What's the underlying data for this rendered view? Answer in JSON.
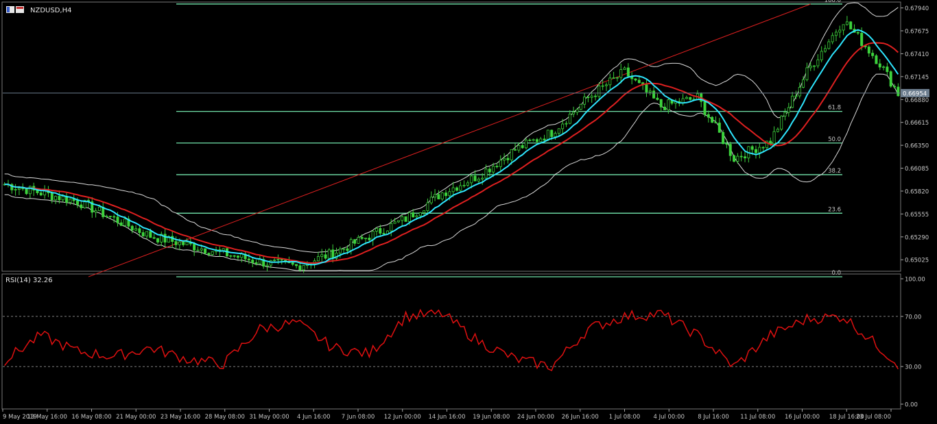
{
  "symbol_title": "NZDUSD,H4",
  "indicator_label": "RSI(14) 32.26",
  "current_price_label": "0.66954",
  "colors": {
    "background": "#000000",
    "candle": "#3cd23c",
    "fib": "#7fffbf",
    "trendline": "#e02020",
    "ma_fast": "#2ee6ff",
    "ma_slow": "#e02020",
    "bands": "#dcdcdc",
    "rsi": "#e01010",
    "axis_text": "#c8c8c8",
    "price_line": "#6d7e8f"
  },
  "chart_data": [
    {
      "type": "line",
      "name": "price",
      "title": "NZDUSD,H4",
      "price_ticks": [
        "0.67940",
        "0.67675",
        "0.67410",
        "0.67145",
        "0.66880",
        "0.66615",
        "0.66350",
        "0.66085",
        "0.65820",
        "0.65555",
        "0.65290",
        "0.65025"
      ],
      "ylim": [
        0.649,
        0.68
      ],
      "current_price": 0.66954,
      "fibonacci_levels": [
        {
          "label": "100.0",
          "price": 0.67985
        },
        {
          "label": "61.8",
          "price": 0.66742
        },
        {
          "label": "50.0",
          "price": 0.66376
        },
        {
          "label": "38.2",
          "price": 0.6601
        },
        {
          "label": "23.6",
          "price": 0.65564
        },
        {
          "label": "0.0",
          "price": 0.64828
        }
      ],
      "trendline": {
        "from": [
          23,
          0.64828
        ],
        "to": [
          221,
          0.67985
        ]
      },
      "x": [
        0,
        10,
        20,
        30,
        40,
        50,
        60,
        70,
        80,
        90,
        100,
        110,
        120,
        130,
        140,
        150,
        160,
        170,
        180,
        190,
        200,
        210,
        220,
        230,
        240,
        245
      ],
      "close": [
        0.659,
        0.658,
        0.657,
        0.655,
        0.653,
        0.652,
        0.651,
        0.65,
        0.6495,
        0.651,
        0.653,
        0.655,
        0.658,
        0.66,
        0.663,
        0.665,
        0.669,
        0.672,
        0.668,
        0.669,
        0.662,
        0.664,
        0.672,
        0.678,
        0.673,
        0.6695
      ]
    },
    {
      "type": "line",
      "name": "rsi",
      "title": "RSI(14) 32.26",
      "rsi_ticks": [
        "100.00",
        "70.00",
        "30.00",
        "0.00"
      ],
      "ylim": [
        0,
        100
      ],
      "levels": [
        70,
        30
      ],
      "x": [
        0,
        10,
        20,
        30,
        40,
        50,
        60,
        70,
        80,
        90,
        100,
        110,
        120,
        130,
        140,
        150,
        160,
        170,
        180,
        190,
        200,
        210,
        220,
        230,
        240,
        245
      ],
      "values": [
        35,
        55,
        42,
        38,
        45,
        36,
        32,
        60,
        65,
        45,
        40,
        70,
        72,
        50,
        36,
        30,
        60,
        70,
        72,
        55,
        30,
        55,
        68,
        70,
        45,
        32
      ]
    }
  ],
  "time_labels": [
    "9 May 2019",
    "13 May 16:00",
    "16 May 08:00",
    "21 May 00:00",
    "23 May 16:00",
    "28 May 08:00",
    "31 May 00:00",
    "4 Jun 16:00",
    "7 Jun 08:00",
    "12 Jun 00:00",
    "14 Jun 16:00",
    "19 Jun 08:00",
    "24 Jun 00:00",
    "26 Jun 16:00",
    "1 Jul 08:00",
    "4 Jul 00:00",
    "8 Jul 16:00",
    "11 Jul 08:00",
    "16 Jul 00:00",
    "18 Jul 16:00",
    "23 Jul 08:00"
  ]
}
